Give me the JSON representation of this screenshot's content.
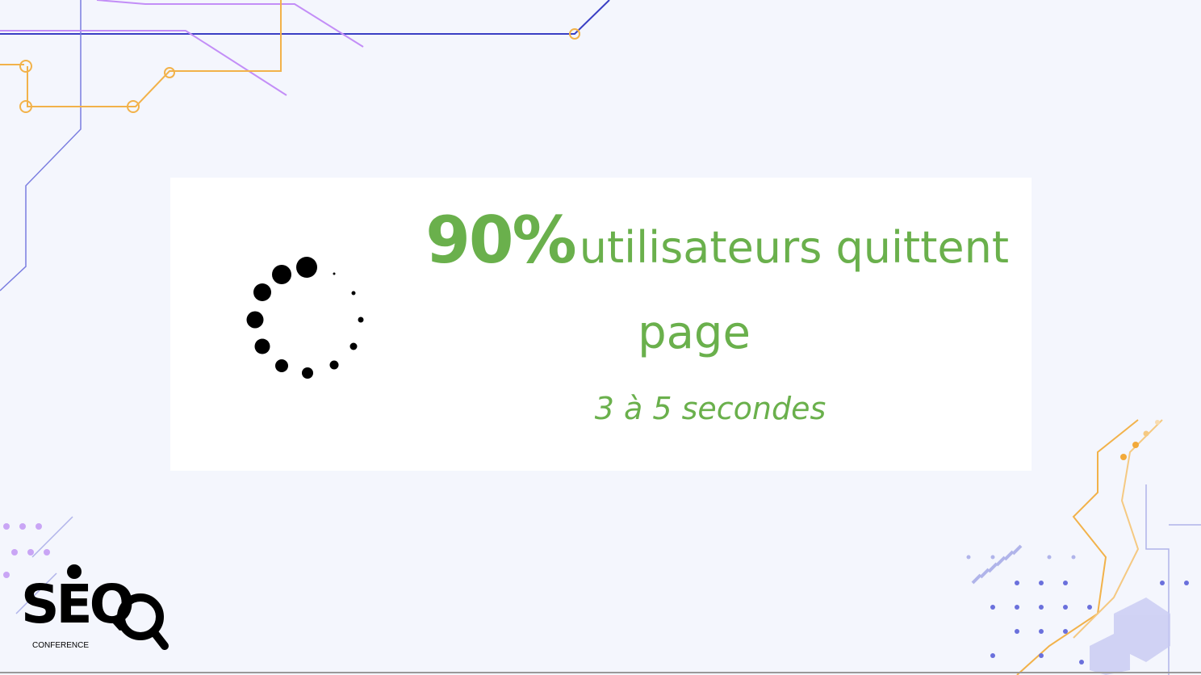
{
  "slide": {
    "stat_value": "90%",
    "stat_text": "utilisateurs quittent",
    "stat_text_line2": "page",
    "subtitle": "3 à 5 secondes"
  },
  "logo": {
    "name": "SEQ",
    "tagline": "CONFERENCE"
  },
  "icons": {
    "spinner": "loading-spinner-icon",
    "logo_magnifier": "magnifier-icon"
  },
  "colors": {
    "accent_green": "#6ab04c",
    "background": "#f4f6fd",
    "circuit_purple": "#b57cf0",
    "circuit_orange": "#f2b24a",
    "circuit_blue": "#3a3fc4"
  }
}
